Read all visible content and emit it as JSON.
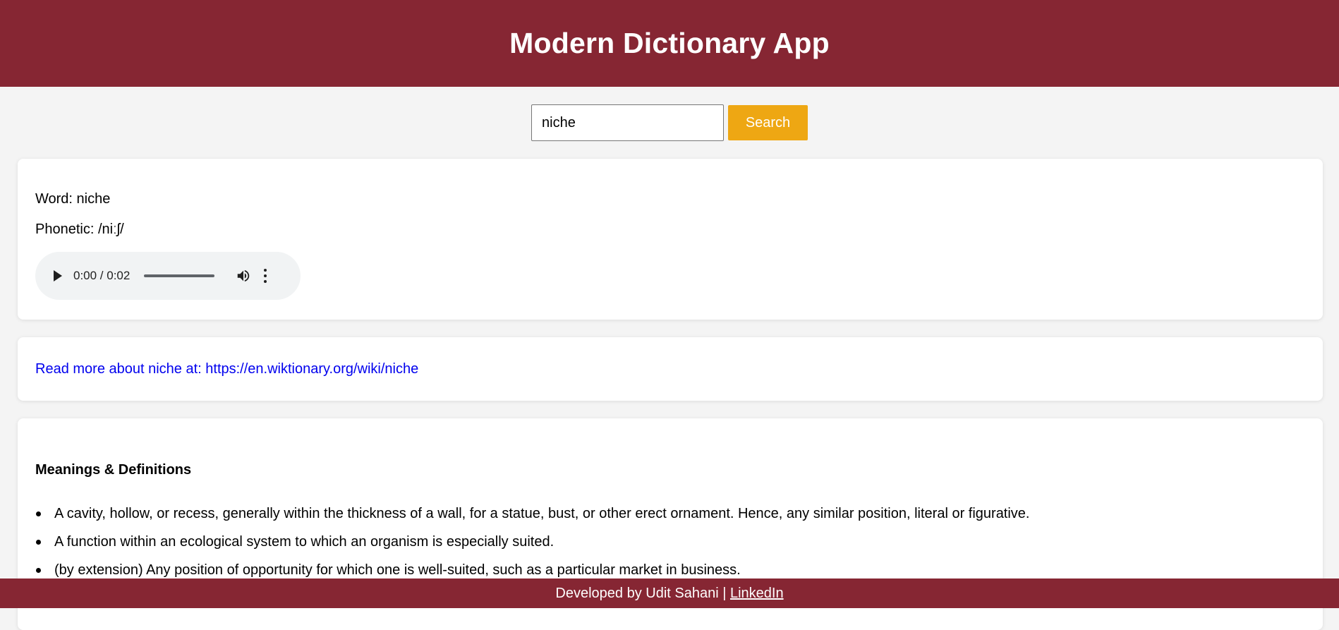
{
  "header": {
    "title": "Modern Dictionary App"
  },
  "search": {
    "value": "niche",
    "button_label": "Search"
  },
  "word_card": {
    "word_line": "Word: niche",
    "phonetic_line": "Phonetic: /niːʃ/",
    "audio": {
      "time_display": "0:00 / 0:02",
      "progress": 0
    }
  },
  "link_card": {
    "text": "Read more about niche at: https://en.wiktionary.org/wiki/niche"
  },
  "meanings": {
    "title": "Meanings & Definitions",
    "definitions": [
      "A cavity, hollow, or recess, generally within the thickness of a wall, for a statue, bust, or other erect ornament. Hence, any similar position, literal or figurative.",
      "A function within an ecological system to which an organism is especially suited.",
      "(by extension) Any position of opportunity for which one is well-suited, such as a particular market in business."
    ]
  },
  "footer": {
    "text": "Developed by Udit Sahani | ",
    "link_label": "LinkedIn"
  },
  "colors": {
    "header_bg": "#862633",
    "accent_button": "#eea713",
    "link": "#0000ee",
    "page_bg": "#f4f4f4"
  },
  "icons": {
    "play": "play-icon",
    "volume": "volume-icon",
    "more": "more-vertical-icon"
  }
}
